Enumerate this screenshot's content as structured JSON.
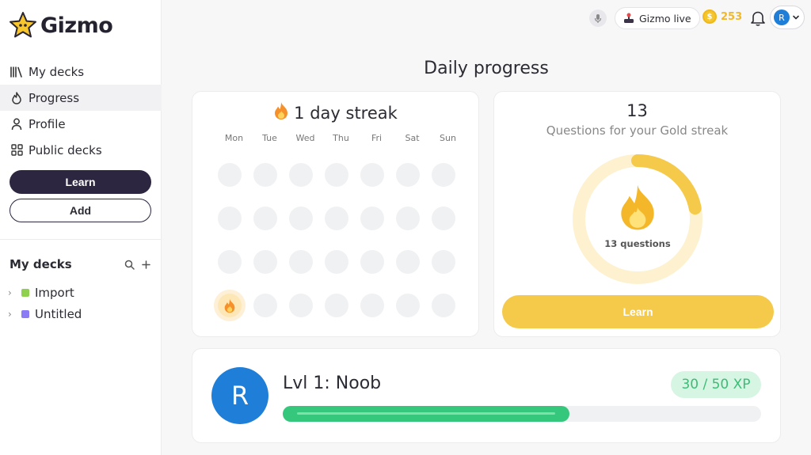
{
  "brand": {
    "name": "Gizmo"
  },
  "sidebar": {
    "nav": [
      {
        "label": "My decks",
        "icon": "library-icon"
      },
      {
        "label": "Progress",
        "icon": "flame-outline-icon",
        "active": true
      },
      {
        "label": "Profile",
        "icon": "user-icon"
      },
      {
        "label": "Public decks",
        "icon": "grid-icon"
      }
    ],
    "learn_label": "Learn",
    "add_label": "Add",
    "mydecks_title": "My decks",
    "decks": [
      {
        "label": "Import",
        "color": "#8fd14f"
      },
      {
        "label": "Untitled",
        "color": "#8b7cf6"
      }
    ]
  },
  "topbar": {
    "live_label": "Gizmo live",
    "coins": "253"
  },
  "user": {
    "initial": "R"
  },
  "page": {
    "title": "Daily progress"
  },
  "streak": {
    "title": "1 day streak",
    "days": [
      "Mon",
      "Tue",
      "Wed",
      "Thu",
      "Fri",
      "Sat",
      "Sun"
    ],
    "completed_cells": [
      21
    ]
  },
  "gold": {
    "count": "13",
    "subtitle": "Questions for your Gold streak",
    "ring_label": "13 questions",
    "learn_label": "Learn",
    "progress": 0.22
  },
  "level": {
    "title": "Lvl 1: Noob",
    "xp_label": "30 / 50 XP",
    "xp_current": 30,
    "xp_max": 50
  },
  "colors": {
    "accent_dark": "#2d2640",
    "gold": "#f5c94a",
    "green": "#35c77b",
    "blue": "#1e7ed8"
  }
}
